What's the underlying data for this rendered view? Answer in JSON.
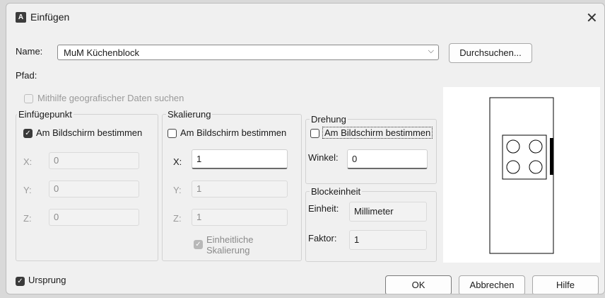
{
  "window": {
    "app_icon": "autocad-icon",
    "app_icon_letter": "A",
    "title": "Einfügen",
    "close_glyph": "✕"
  },
  "name_row": {
    "label": "Name:",
    "value": "MuM Küchenblock",
    "dropdown_glyph": "⌵"
  },
  "browse_button": "Durchsuchen...",
  "path_label": "Pfad:",
  "geo_checkbox": {
    "label": "Mithilfe geografischer Daten suchen",
    "checked": false,
    "enabled": false
  },
  "insertion_point": {
    "title": "Einfügepunkt",
    "on_screen": {
      "label": "Am Bildschirm bestimmen",
      "checked": true
    },
    "x": {
      "label": "X:",
      "value": "0"
    },
    "y": {
      "label": "Y:",
      "value": "0"
    },
    "z": {
      "label": "Z:",
      "value": "0"
    }
  },
  "scaling": {
    "title": "Skalierung",
    "on_screen": {
      "label": "Am Bildschirm bestimmen",
      "checked": false
    },
    "x": {
      "label": "X:",
      "value": "1"
    },
    "y": {
      "label": "Y:",
      "value": "1"
    },
    "z": {
      "label": "Z:",
      "value": "1"
    },
    "uniform": {
      "label_line1": "Einheitliche",
      "label_line2": "Skalierung",
      "checked": true,
      "enabled": false
    }
  },
  "rotation": {
    "title": "Drehung",
    "on_screen": {
      "label": "Am Bildschirm bestimmen",
      "checked": false
    },
    "angle": {
      "label": "Winkel:",
      "value": "0"
    }
  },
  "block_unit": {
    "title": "Blockeinheit",
    "unit": {
      "label": "Einheit:",
      "value": "Millimeter"
    },
    "factor": {
      "label": "Faktor:",
      "value": "1"
    }
  },
  "explode_checkbox": {
    "label": "Ursprung",
    "checked": true
  },
  "buttons": {
    "ok": "OK",
    "cancel": "Abbrechen",
    "help": "Hilfe"
  },
  "colors": {
    "dialog_bg": "#f0f0f0",
    "checkbox_checked": "#3a3a3a",
    "preview_bg": "#ffffff"
  }
}
